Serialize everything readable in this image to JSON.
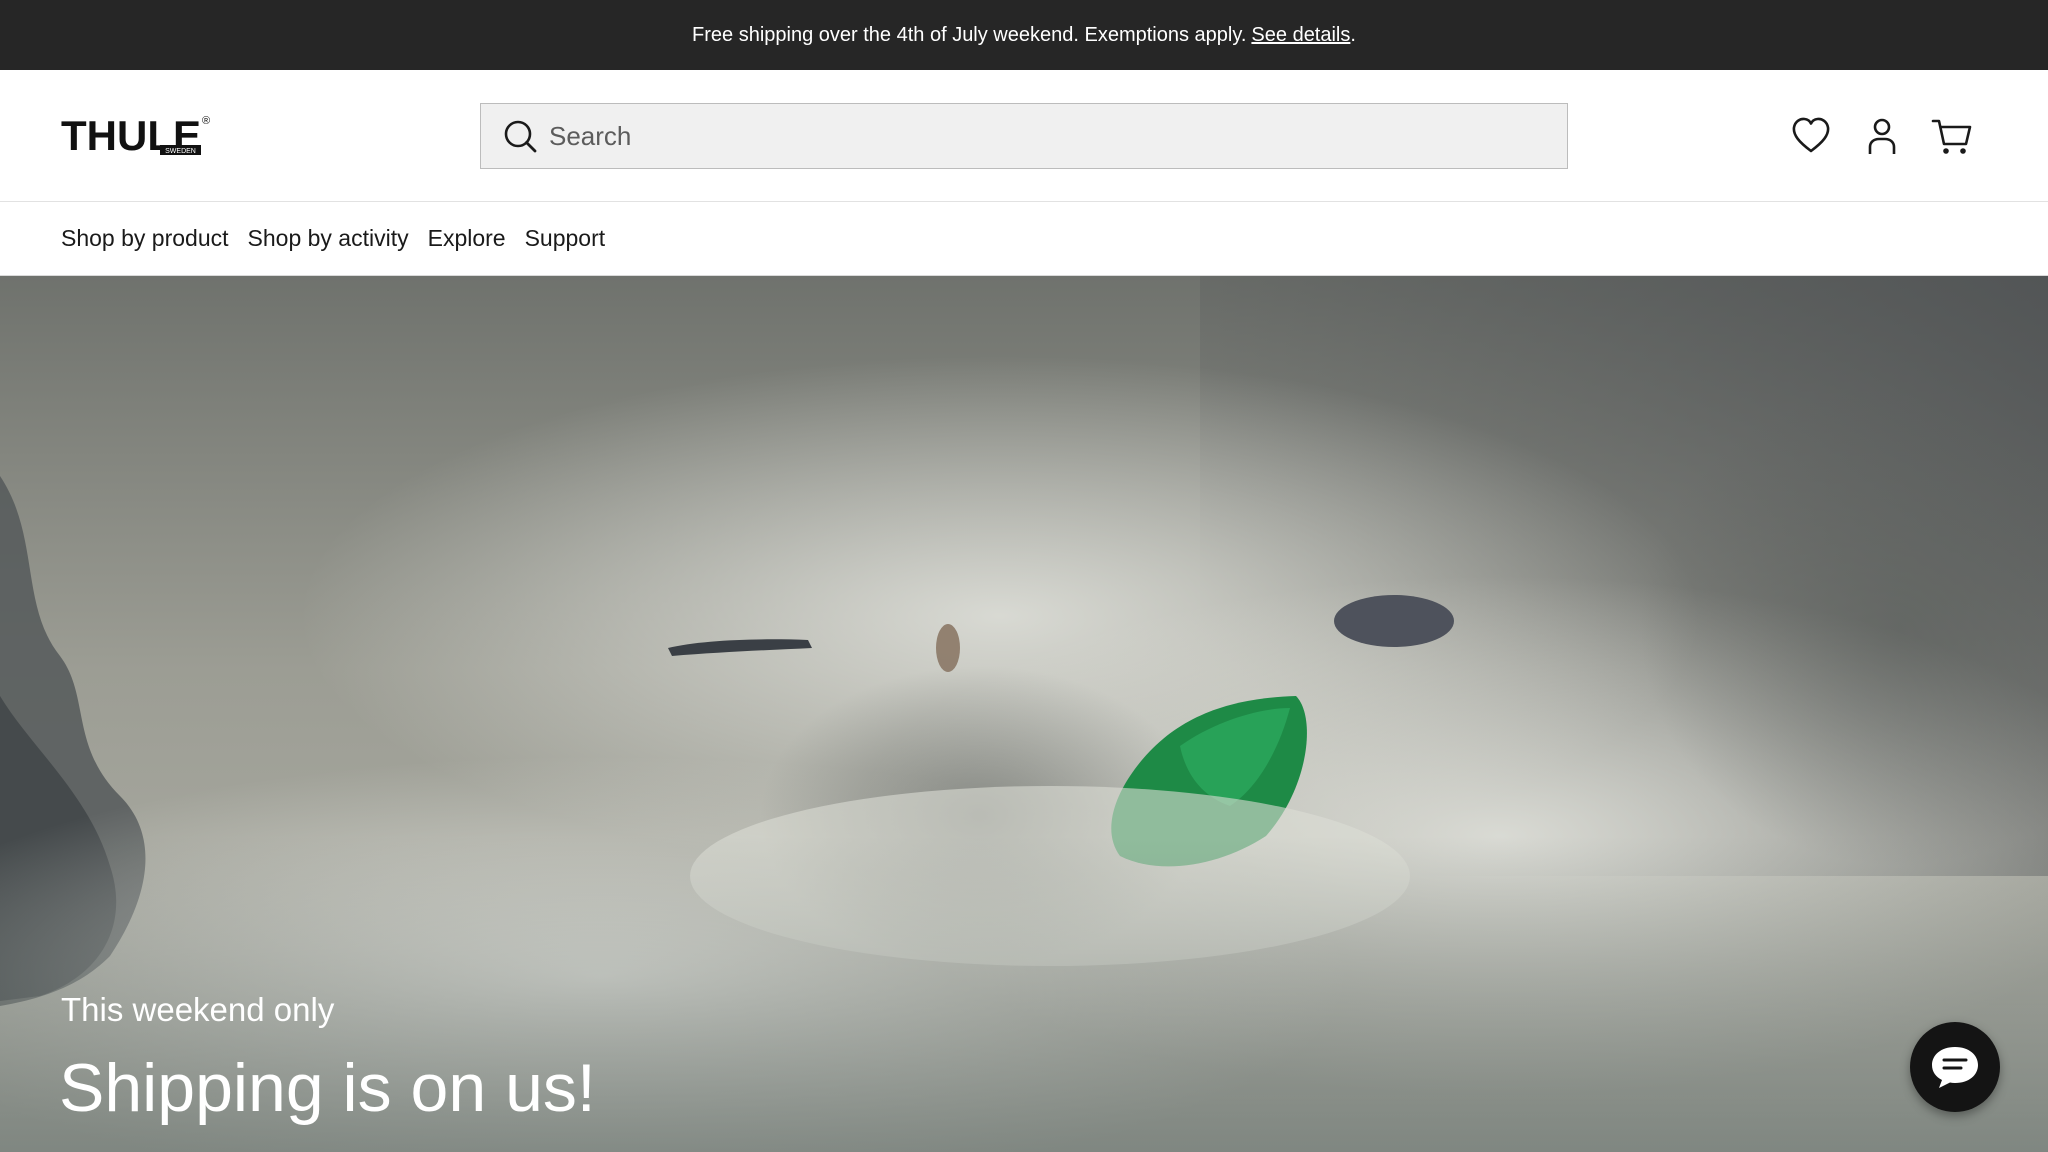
{
  "promo": {
    "text": "Free shipping over the 4th of July weekend. Exemptions apply.",
    "link_label": "See details",
    "trailing": "."
  },
  "header": {
    "logo": {
      "wordmark": "THULE",
      "sub_mark": "SWEDEN",
      "registered_mark": "®",
      "icon": "thule-logo"
    },
    "search": {
      "placeholder": "Search",
      "value": "",
      "icon": "search-icon"
    },
    "icons": [
      {
        "name": "wishlist",
        "icon": "heart-icon"
      },
      {
        "name": "account",
        "icon": "user-icon"
      },
      {
        "name": "cart",
        "icon": "cart-icon"
      }
    ]
  },
  "nav": {
    "items": [
      {
        "label": "Shop by product"
      },
      {
        "label": "Shop by activity"
      },
      {
        "label": "Explore"
      },
      {
        "label": "Support"
      }
    ]
  },
  "hero": {
    "eyebrow": "This weekend only",
    "title": "Shipping is on us!",
    "image": "whitewater-kayaker-photo"
  },
  "chat": {
    "icon": "chat-bubble-icon"
  },
  "colors": {
    "promo_bar_bg": "#262626",
    "search_bg": "#f0f0f0",
    "chat_button_bg": "#141414",
    "kayak_green": "#1e8a46"
  }
}
